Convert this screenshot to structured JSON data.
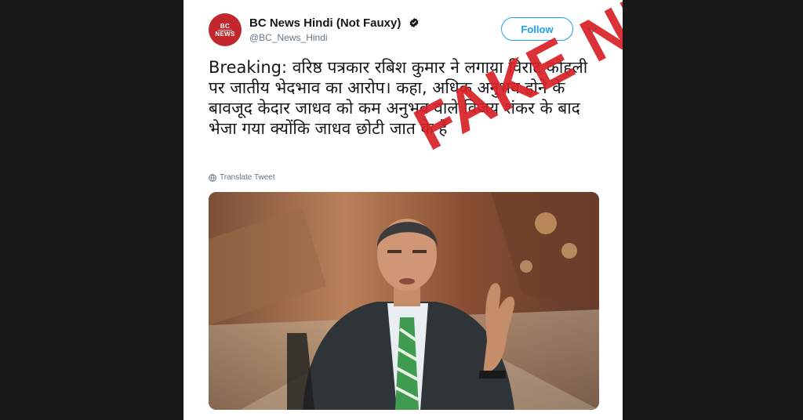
{
  "account": {
    "avatar_line1": "BC",
    "avatar_line2": "NEWS",
    "name": "BC News Hindi (Not Fauxy)",
    "handle": "@BC_News_Hindi",
    "verified_icon": "verified-badge-icon"
  },
  "actions": {
    "follow_label": "Follow",
    "more_icon": "chevron-down-icon"
  },
  "tweet": {
    "text": "Breaking: वरिष्ठ पत्रकार रबिश कुमार ने लगाया विराट कोहली पर जातीय भेदभाव का आरोप। कहा, अधिक अनुभव होने के बावजूद केदार जाधव को कम अनुभव वाले विजय शंकर के बाद भेजा गया क्योंकि जाधव छोटी जात के हैं",
    "translate_label": "Translate Tweet"
  },
  "overlay": {
    "stamp_text": "FAKE NEWS",
    "stamp_color": "#d92127"
  },
  "colors": {
    "accent": "#1da1f2",
    "brand_red": "#c1272d"
  }
}
